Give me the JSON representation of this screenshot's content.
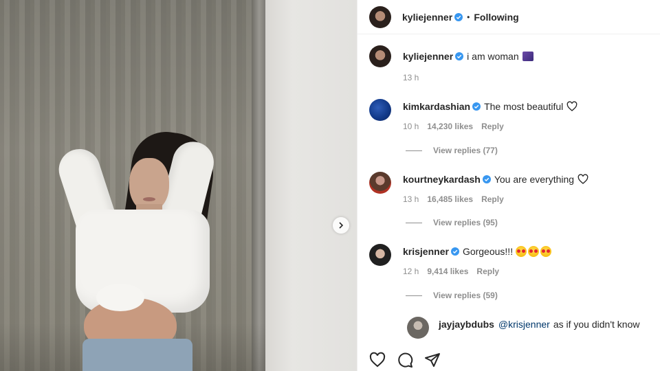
{
  "post": {
    "author": "kyliejenner",
    "follow_status": "Following",
    "caption": "i am woman",
    "caption_time": "13 h"
  },
  "comments": [
    {
      "user": "kimkardashian",
      "text": "The most beautiful",
      "time": "10 h",
      "likes": "14,230 likes",
      "reply": "Reply",
      "view_replies": "View replies (77)"
    },
    {
      "user": "kourtneykardash",
      "text": "You are everything",
      "time": "13 h",
      "likes": "16,485 likes",
      "reply": "Reply",
      "view_replies": "View replies (95)"
    },
    {
      "user": "krisjenner",
      "text": "Gorgeous!!!",
      "time": "12 h",
      "likes": "9,414 likes",
      "reply": "Reply",
      "view_replies": "View replies (59)"
    }
  ],
  "reply": {
    "user": "jayjaybdubs",
    "mention": "@krisjenner",
    "text": "as if you didn't know"
  },
  "icons": {
    "verified": "verified-badge-icon",
    "heart": "heart-icon",
    "comment": "comment-icon",
    "share": "send-icon",
    "next": "chevron-right-icon"
  },
  "colors": {
    "verified": "#3897f0",
    "muted": "#8e8e8e",
    "text": "#262626"
  }
}
